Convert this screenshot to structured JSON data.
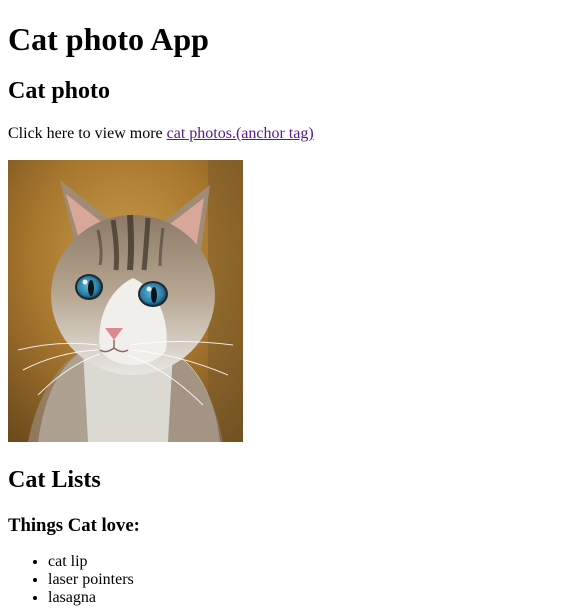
{
  "header": {
    "title": "Cat photo App"
  },
  "photo_section": {
    "heading": "Cat photo",
    "intro_text": "Click here to view more ",
    "link_text": "cat photos.(anchor tag)",
    "link_color": "#551a8b"
  },
  "lists_section": {
    "heading": "Cat Lists",
    "subheading": "Things Cat love:",
    "items": [
      "cat lip",
      "laser pointers",
      "lasagna"
    ]
  }
}
